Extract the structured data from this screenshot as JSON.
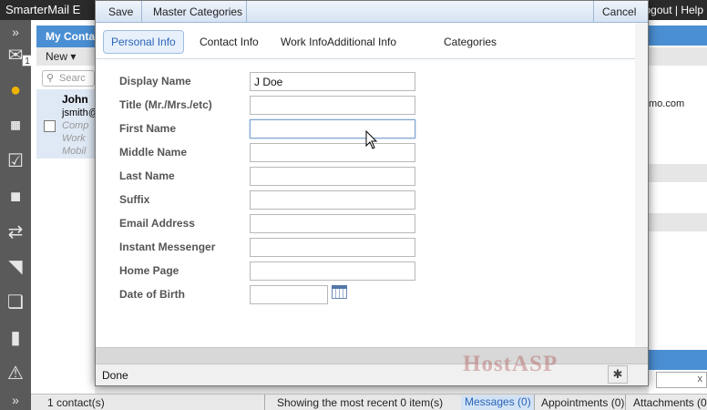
{
  "app": {
    "title": "SmarterMail E",
    "header_links": "ogout | Help"
  },
  "rail": {
    "inbox_badge": "1"
  },
  "contacts": {
    "header": "My Conta",
    "new_label": "New ▾",
    "search_placeholder": "Searc",
    "item": {
      "name": "John",
      "email": "jsmith@",
      "line1": "Comp",
      "line2": "Work",
      "line3": "Mobil"
    }
  },
  "right_pane": {
    "email_fragment": "mo.com"
  },
  "status_bar": {
    "contact_count": "1 contact(s)",
    "recent_items": "Showing the most recent 0 item(s)",
    "messages": "Messages (0)",
    "appointments": "Appointments (0)",
    "attachments": "Attachments (0)"
  },
  "modal": {
    "toolbar": {
      "save": "Save",
      "master_categories": "Master Categories",
      "cancel": "Cancel"
    },
    "tabs": [
      "Personal Info",
      "Contact Info",
      "Work Info",
      "Additional Info",
      "Categories"
    ],
    "active_tab": "Personal Info",
    "fields": [
      {
        "label": "Display Name",
        "value": "J Doe"
      },
      {
        "label": "Title (Mr./Mrs./etc)",
        "value": ""
      },
      {
        "label": "First Name",
        "value": ""
      },
      {
        "label": "Middle Name",
        "value": ""
      },
      {
        "label": "Last Name",
        "value": ""
      },
      {
        "label": "Suffix",
        "value": ""
      },
      {
        "label": "Email Address",
        "value": ""
      },
      {
        "label": "Instant Messenger",
        "value": ""
      },
      {
        "label": "Home Page",
        "value": ""
      },
      {
        "label": "Date of Birth",
        "value": ""
      }
    ],
    "status": "Done"
  },
  "watermark": "HostASP",
  "colors": {
    "accent": "#4a8fd3",
    "active_tab_text": "#2a64b7",
    "rail": "#5a5a5a",
    "active_rail_icon": "#f0b400"
  },
  "icons": [
    "expand-icon",
    "mail-icon",
    "contacts-icon",
    "calendar-icon",
    "tasks-icon",
    "notes-icon",
    "sync-icon",
    "rss-icon",
    "files-icon",
    "reports-icon",
    "alerts-icon",
    "calendar-picker-icon",
    "bug-icon",
    "search-icon",
    "mouse-cursor-icon"
  ]
}
